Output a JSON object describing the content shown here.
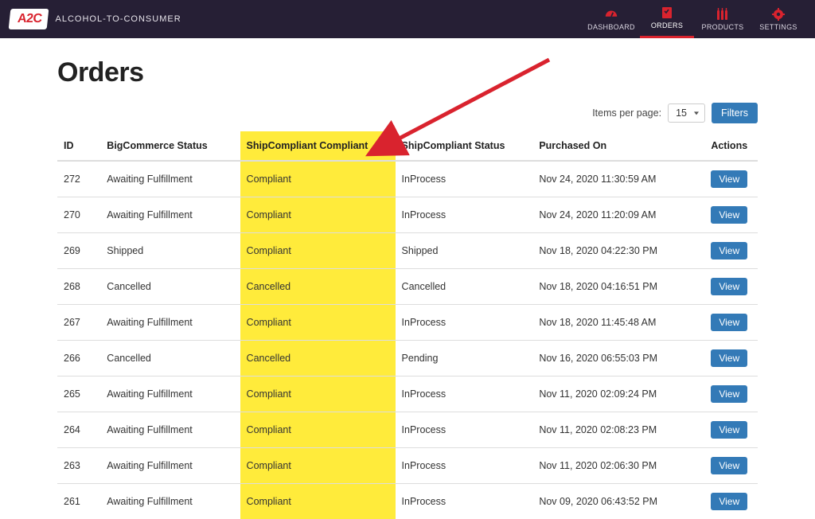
{
  "brand": {
    "logo": "A2C",
    "text": "ALCOHOL-TO-CONSUMER"
  },
  "nav": {
    "dashboard": "DASHBOARD",
    "orders": "ORDERS",
    "products": "PRODUCTS",
    "settings": "SETTINGS"
  },
  "page": {
    "title": "Orders",
    "items_per_page_label": "Items per page:",
    "items_per_page_value": "15",
    "filters_label": "Filters"
  },
  "columns": {
    "id": "ID",
    "bc_status": "BigCommerce Status",
    "sc_compliant": "ShipCompliant Compliant",
    "sc_status": "ShipCompliant Status",
    "purchased_on": "Purchased On",
    "actions": "Actions"
  },
  "action_label": "View",
  "rows": [
    {
      "id": "272",
      "bc_status": "Awaiting Fulfillment",
      "sc_compliant": "Compliant",
      "sc_status": "InProcess",
      "purchased_on": "Nov 24, 2020 11:30:59 AM"
    },
    {
      "id": "270",
      "bc_status": "Awaiting Fulfillment",
      "sc_compliant": "Compliant",
      "sc_status": "InProcess",
      "purchased_on": "Nov 24, 2020 11:20:09 AM"
    },
    {
      "id": "269",
      "bc_status": "Shipped",
      "sc_compliant": "Compliant",
      "sc_status": "Shipped",
      "purchased_on": "Nov 18, 2020 04:22:30 PM"
    },
    {
      "id": "268",
      "bc_status": "Cancelled",
      "sc_compliant": "Cancelled",
      "sc_status": "Cancelled",
      "purchased_on": "Nov 18, 2020 04:16:51 PM"
    },
    {
      "id": "267",
      "bc_status": "Awaiting Fulfillment",
      "sc_compliant": "Compliant",
      "sc_status": "InProcess",
      "purchased_on": "Nov 18, 2020 11:45:48 AM"
    },
    {
      "id": "266",
      "bc_status": "Cancelled",
      "sc_compliant": "Cancelled",
      "sc_status": "Pending",
      "purchased_on": "Nov 16, 2020 06:55:03 PM"
    },
    {
      "id": "265",
      "bc_status": "Awaiting Fulfillment",
      "sc_compliant": "Compliant",
      "sc_status": "InProcess",
      "purchased_on": "Nov 11, 2020 02:09:24 PM"
    },
    {
      "id": "264",
      "bc_status": "Awaiting Fulfillment",
      "sc_compliant": "Compliant",
      "sc_status": "InProcess",
      "purchased_on": "Nov 11, 2020 02:08:23 PM"
    },
    {
      "id": "263",
      "bc_status": "Awaiting Fulfillment",
      "sc_compliant": "Compliant",
      "sc_status": "InProcess",
      "purchased_on": "Nov 11, 2020 02:06:30 PM"
    },
    {
      "id": "261",
      "bc_status": "Awaiting Fulfillment",
      "sc_compliant": "Compliant",
      "sc_status": "InProcess",
      "purchased_on": "Nov 09, 2020 06:43:52 PM"
    }
  ]
}
